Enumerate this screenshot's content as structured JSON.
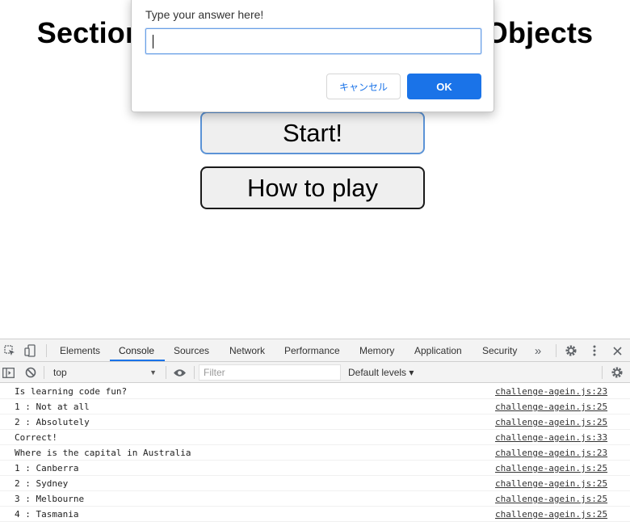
{
  "page": {
    "title": "Section 5 Challenge Arrays and Objects",
    "start_label": "Start!",
    "howto_label": "How to play"
  },
  "dialog": {
    "message": "Type your answer here!",
    "input_value": "",
    "cancel_label": "キャンセル",
    "ok_label": "OK",
    "accent_color": "#1a73e8"
  },
  "devtools": {
    "icons": {
      "inspect": "inspect-element-icon",
      "device": "device-toolbar-icon",
      "more_tabs": "chevron-double-right-icon",
      "settings": "gear-icon",
      "menu": "kebab-menu-icon",
      "close": "close-icon",
      "sidebar": "sidebar-toggle-icon",
      "clear": "clear-console-icon",
      "eye": "eye-icon",
      "console_settings": "gear-icon"
    },
    "tabs": [
      "Elements",
      "Console",
      "Sources",
      "Network",
      "Performance",
      "Memory",
      "Application",
      "Security"
    ],
    "active_tab": "Console",
    "more_tabs_label": "»",
    "context": "top",
    "filter_placeholder": "Filter",
    "levels_label": "Default levels ▾",
    "logs": [
      {
        "msg": "Is learning code fun?",
        "src": "challenge-agein.js:23"
      },
      {
        "msg": "1 : Not at all",
        "src": "challenge-agein.js:25"
      },
      {
        "msg": "2 : Absolutely",
        "src": "challenge-agein.js:25"
      },
      {
        "msg": "Correct!",
        "src": "challenge-agein.js:33"
      },
      {
        "msg": "Where is the capital in Australia",
        "src": "challenge-agein.js:23"
      },
      {
        "msg": "1 : Canberra",
        "src": "challenge-agein.js:25"
      },
      {
        "msg": "2 : Sydney",
        "src": "challenge-agein.js:25"
      },
      {
        "msg": "3 : Melbourne",
        "src": "challenge-agein.js:25"
      },
      {
        "msg": "4 : Tasmania",
        "src": "challenge-agein.js:25"
      }
    ]
  }
}
